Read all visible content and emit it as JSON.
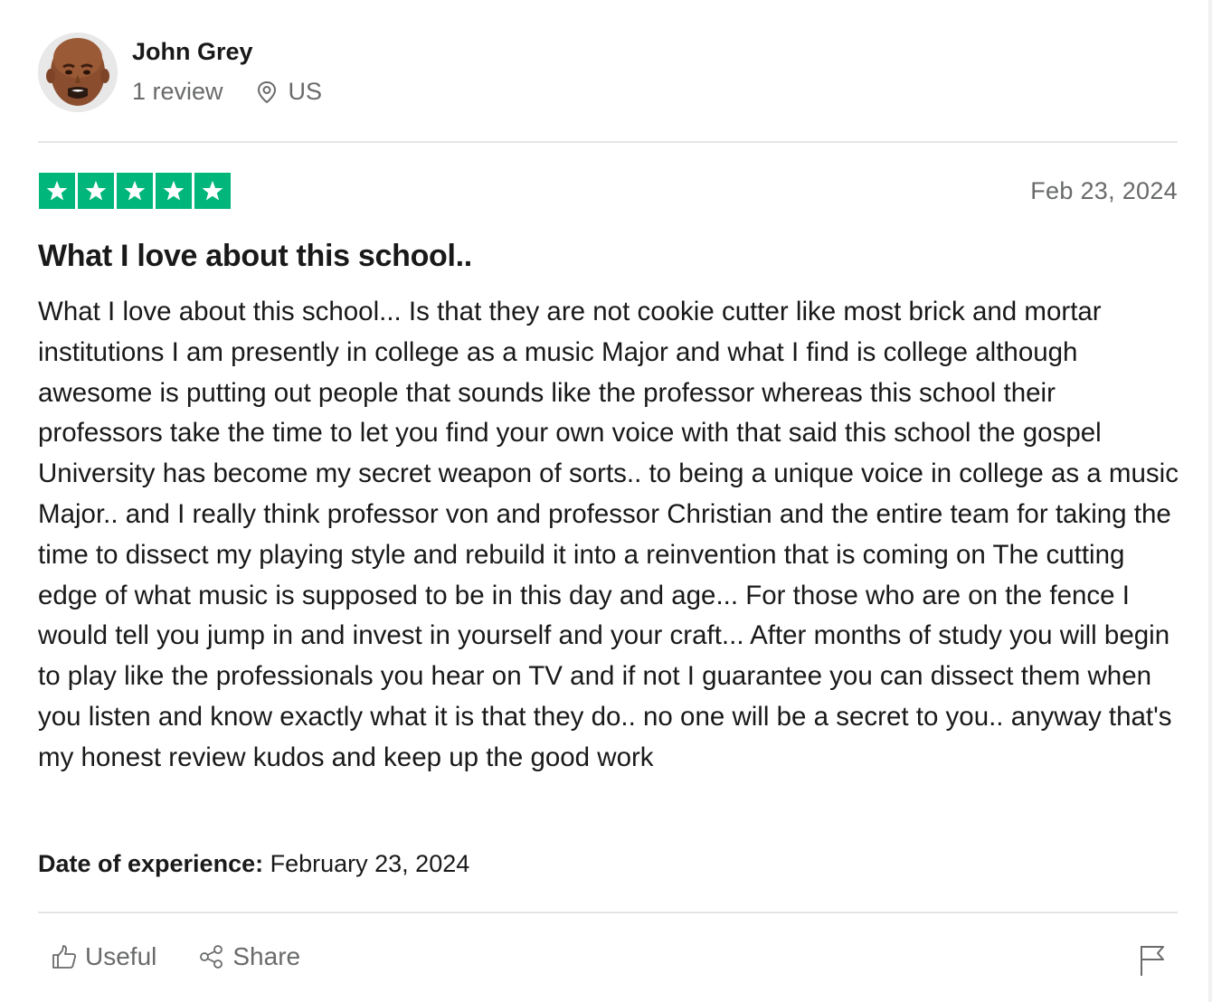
{
  "reviewer": {
    "name": "John Grey",
    "review_count": "1 review",
    "country": "US"
  },
  "review": {
    "rating": 5,
    "rating_max": 5,
    "date": "Feb 23, 2024",
    "title": "What I love about this school..",
    "body": "What I love about this school... Is that they are not cookie cutter like most brick and mortar institutions I am presently in college as a music Major and what I find is college although awesome is putting out people that sounds like the professor whereas this school their professors take the time to let you find your own voice with that said this school the gospel University has become my secret weapon of sorts.. to being a unique voice in college as a music Major.. and I really think professor von and professor Christian and the entire team for taking the time to dissect my playing style and rebuild it into a reinvention that is coming on The cutting edge of what music is supposed to be in this day and age... For those who are on the fence I would tell you jump in and invest in yourself and your craft... After months of study you will begin to play like the professionals you hear on TV and if not I guarantee you can dissect them when you listen and know exactly what it is that they do.. no one will be a secret to you.. anyway that's my honest review kudos and keep up the good work",
    "experience_label": "Date of experience:",
    "experience_date": "February 23, 2024"
  },
  "actions": {
    "useful_label": "Useful",
    "share_label": "Share"
  },
  "icons": {
    "location": "location-pin-icon",
    "useful": "thumbs-up-icon",
    "share": "share-icon",
    "flag": "flag-icon",
    "star": "star-icon"
  },
  "colors": {
    "star_green": "#00b67a",
    "muted_text": "#696a6a",
    "text": "#191919",
    "divider": "#e5e5e5"
  }
}
